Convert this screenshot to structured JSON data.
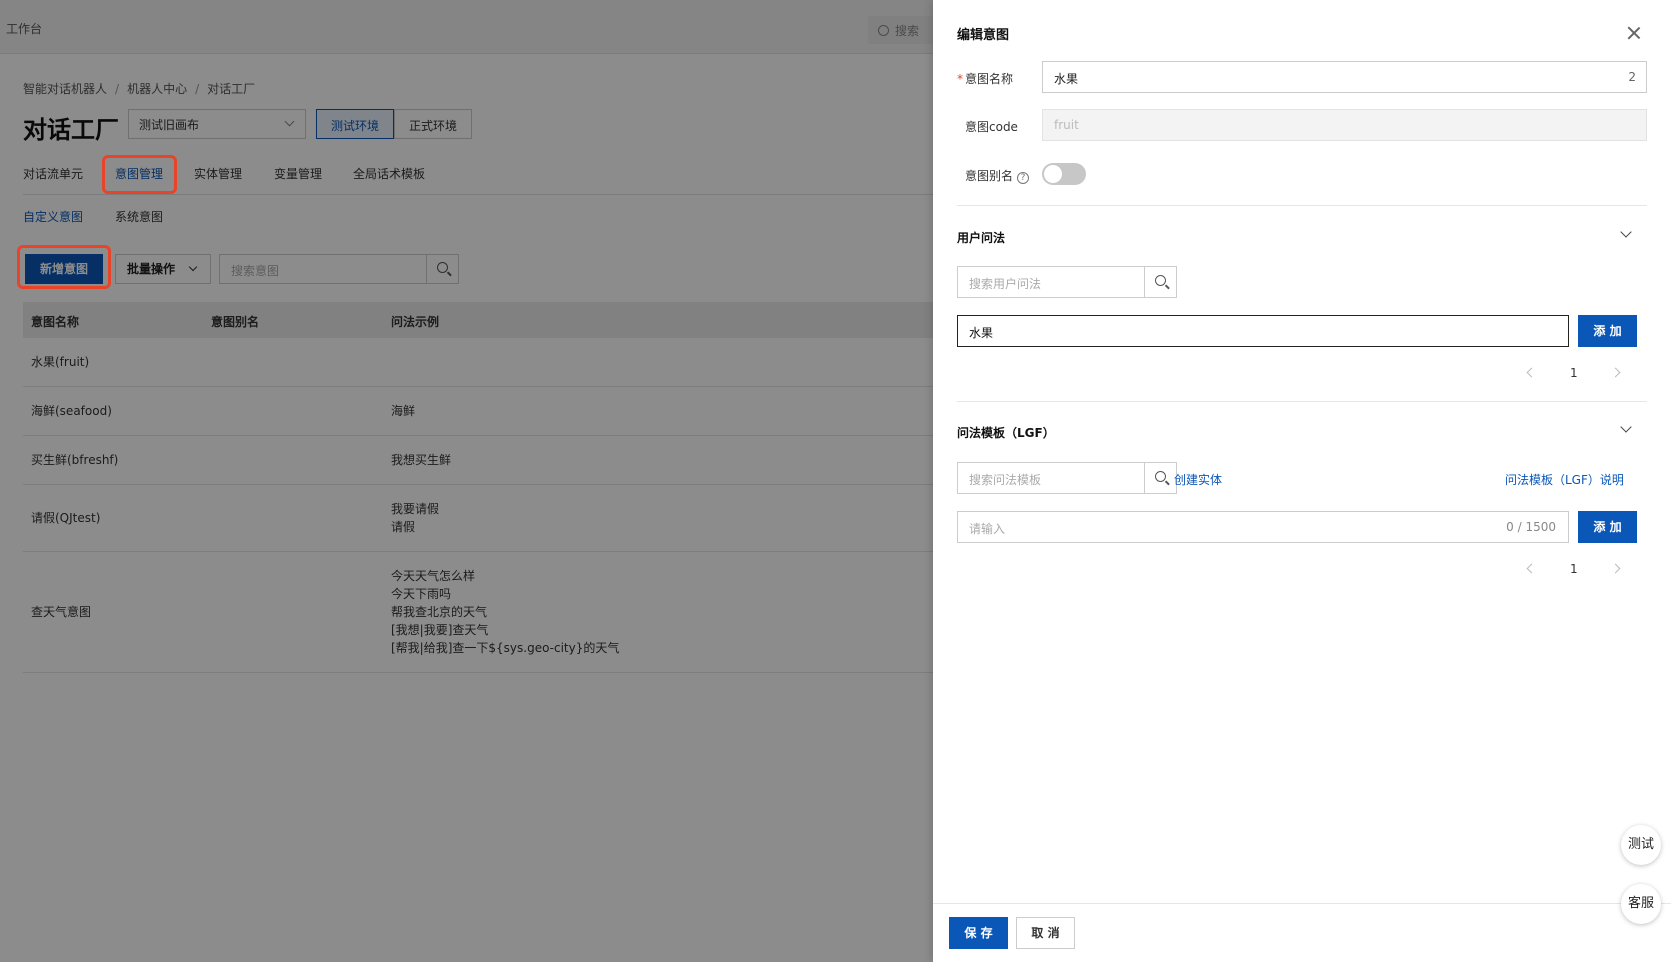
{
  "topbar": {
    "workbench": "工作台",
    "search_placeholder": "搜索"
  },
  "breadcrumb": [
    "智能对话机器人",
    "机器人中心",
    "对话工厂"
  ],
  "page_title": "对话工厂",
  "release_select": {
    "value": "测试旧画布"
  },
  "env_buttons": {
    "test": "测试环境",
    "prod": "正式环境"
  },
  "main_tabs": [
    "对话流单元",
    "意图管理",
    "实体管理",
    "变量管理",
    "全局话术模板"
  ],
  "sub_tabs": [
    "自定义意图",
    "系统意图"
  ],
  "toolbar": {
    "new_intent": "新增意图",
    "batch_ops": "批量操作",
    "search_placeholder": "搜索意图"
  },
  "table": {
    "headers": [
      "意图名称",
      "意图别名",
      "问法示例"
    ],
    "rows": [
      {
        "name": "水果(fruit)",
        "alias": "",
        "examples": []
      },
      {
        "name": "海鲜(seafood)",
        "alias": "",
        "examples": [
          "海鲜"
        ]
      },
      {
        "name": "买生鲜(bfreshf)",
        "alias": "",
        "examples": [
          "我想买生鲜"
        ]
      },
      {
        "name": "请假(QJtest)",
        "alias": "",
        "examples": [
          "我要请假",
          "请假"
        ]
      },
      {
        "name": "查天气意图",
        "alias": "",
        "examples": [
          "今天天气怎么样",
          "今天下雨吗",
          "帮我查北京的天气",
          "[我想|我要]查天气",
          "[帮我|给我]查一下${sys.geo-city}的天气"
        ]
      }
    ]
  },
  "drawer": {
    "title": "编辑意图",
    "intent_name_label": "意图名称",
    "intent_name_value": "水果",
    "intent_name_count": "2",
    "intent_code_label": "意图code",
    "intent_code_value": "fruit",
    "intent_alias_label": "意图别名",
    "user_queries": {
      "title": "用户问法",
      "search_placeholder": "搜索用户问法",
      "input_value": "水果",
      "add_label": "添 加",
      "page": "1"
    },
    "lgf": {
      "title": "问法模板（LGF）",
      "search_placeholder": "搜索问法模板",
      "create_entity": "创建实体",
      "help_link": "问法模板（LGF）说明",
      "input_placeholder": "请输入",
      "input_count": "0 / 1500",
      "add_label": "添 加",
      "page": "1"
    },
    "save_label": "保 存",
    "cancel_label": "取 消"
  },
  "float_buttons": {
    "test": "测试",
    "service": "客服"
  },
  "colors": {
    "primary": "#0a57b8",
    "highlight": "#e8442a"
  }
}
